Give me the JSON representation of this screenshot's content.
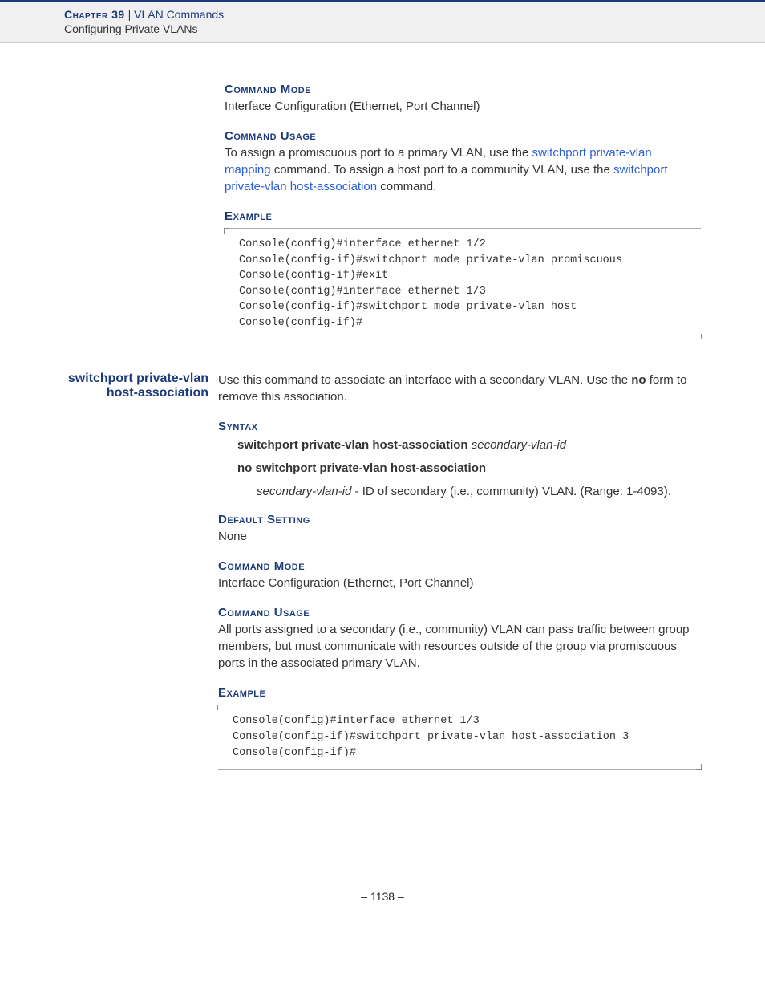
{
  "header": {
    "chapter_label": "Chapter 39",
    "divider": "  |  ",
    "chapter_title": "VLAN Commands",
    "subtitle": "Configuring Private VLANs"
  },
  "sec1": {
    "cmd_mode_head": "Command Mode",
    "cmd_mode_text": "Interface Configuration (Ethernet, Port Channel)",
    "cmd_usage_head": "Command Usage",
    "cmd_usage_pre": "To assign a promiscuous port to a primary VLAN, use the ",
    "link1": "switchport private-vlan mapping",
    "cmd_usage_mid": " command. To assign a host port to a community VLAN, use the ",
    "link2": "switchport private-vlan host-association",
    "cmd_usage_post": " command.",
    "example_head": "Example",
    "example_code": "Console(config)#interface ethernet 1/2\nConsole(config-if)#switchport mode private-vlan promiscuous\nConsole(config-if)#exit\nConsole(config)#interface ethernet 1/3\nConsole(config-if)#switchport mode private-vlan host\nConsole(config-if)#"
  },
  "sec2": {
    "margin_title": "switchport private-vlan host-association",
    "intro_pre": "Use this command to associate an interface with a secondary VLAN. Use the ",
    "intro_no": "no",
    "intro_post": " form to remove this association.",
    "syntax_head": "Syntax",
    "syntax_cmd_bold": "switchport private-vlan host-association",
    "syntax_cmd_ital": "secondary-vlan-id",
    "syntax_no": "no switchport private-vlan host-association",
    "param_ital": "secondary-vlan-id",
    "param_desc": " - ID of secondary (i.e., community) VLAN. (Range: 1-4093).",
    "default_head": "Default Setting",
    "default_text": "None",
    "cmd_mode_head": "Command Mode",
    "cmd_mode_text": "Interface Configuration (Ethernet, Port Channel)",
    "cmd_usage_head": "Command Usage",
    "cmd_usage_text": "All ports assigned to a secondary (i.e., community) VLAN can pass traffic between group members, but must communicate with resources outside of the group via promiscuous ports in the associated primary VLAN.",
    "example_head": "Example",
    "example_code": "Console(config)#interface ethernet 1/3\nConsole(config-if)#switchport private-vlan host-association 3\nConsole(config-if)#"
  },
  "page_number": "–  1138  –"
}
